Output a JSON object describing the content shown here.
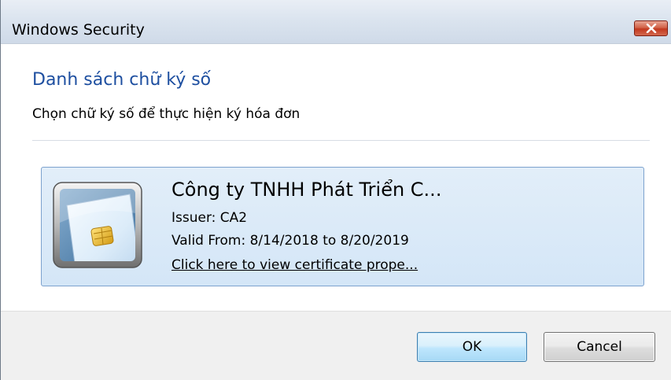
{
  "window": {
    "title": "Windows Security"
  },
  "dialog": {
    "heading": "Danh sách chữ ký số",
    "subheading": "Chọn chữ ký số để thực hiện ký hóa đơn"
  },
  "certificate": {
    "name": "Công ty TNHH Phát Triển C...",
    "issuer": "Issuer: CA2",
    "valid": "Valid From: 8/14/2018 to 8/20/2019",
    "link": "Click here to view certificate prope...",
    "icon": "smart-card-icon"
  },
  "buttons": {
    "ok": "OK",
    "cancel": "Cancel"
  },
  "icons": {
    "close": "close-icon"
  },
  "colors": {
    "heading": "#1e4fa0",
    "tile_border": "#7da2ce",
    "tile_bg": "#d4e6f7",
    "close_button": "#c2381f"
  }
}
